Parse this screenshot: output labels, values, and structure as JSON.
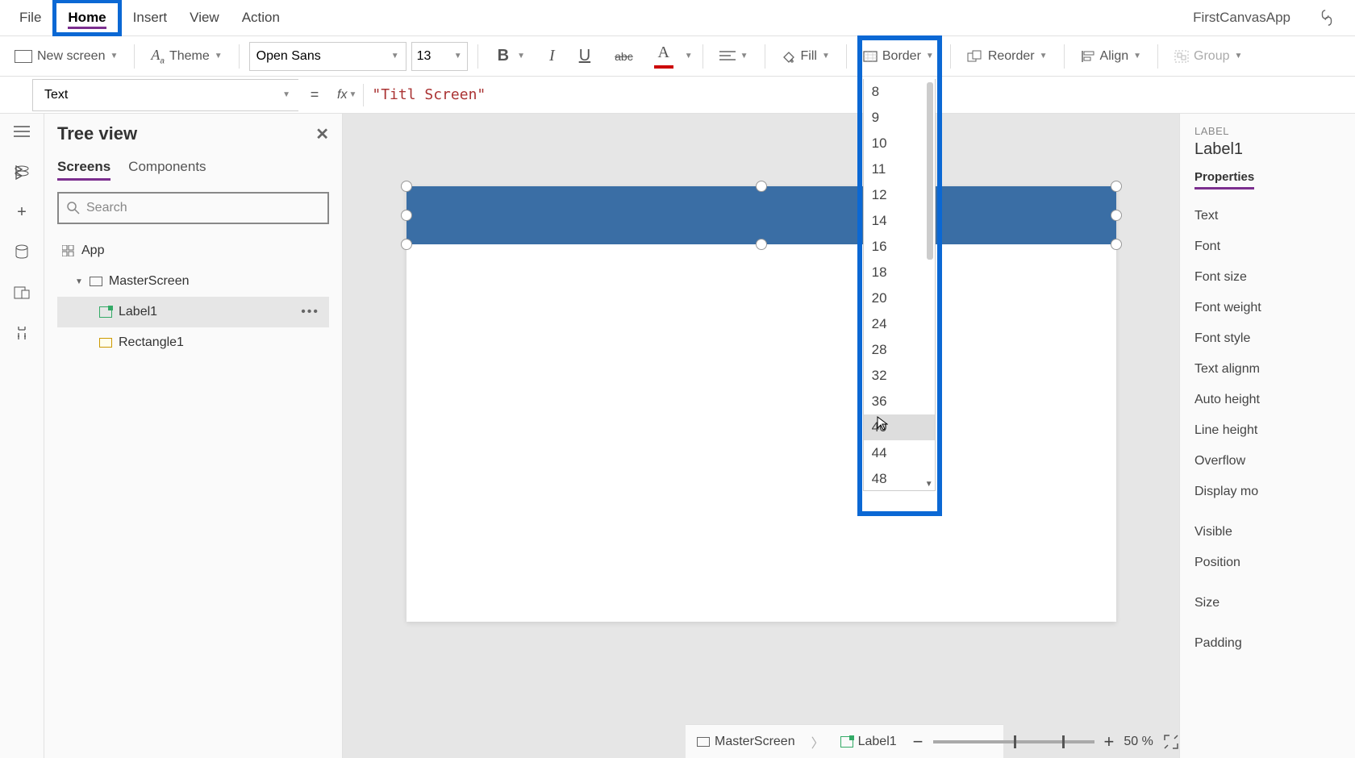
{
  "app_title": "FirstCanvasApp",
  "menu": {
    "file": "File",
    "home": "Home",
    "insert": "Insert",
    "view": "View",
    "action": "Action"
  },
  "toolbar": {
    "new_screen": "New screen",
    "theme": "Theme",
    "font_name": "Open Sans",
    "font_size": "13",
    "fill": "Fill",
    "border": "Border",
    "reorder": "Reorder",
    "align": "Align",
    "group": "Group"
  },
  "font_sizes": [
    "8",
    "9",
    "10",
    "11",
    "12",
    "14",
    "16",
    "18",
    "20",
    "24",
    "28",
    "32",
    "36",
    "40",
    "44",
    "48"
  ],
  "font_size_hovered_index": 13,
  "formula": {
    "property": "Text",
    "value": "\"Titl        Screen\""
  },
  "tree": {
    "title": "Tree view",
    "tabs": {
      "screens": "Screens",
      "components": "Components"
    },
    "search_placeholder": "Search",
    "items": {
      "app": "App",
      "screen": "MasterScreen",
      "label": "Label1",
      "rect": "Rectangle1"
    }
  },
  "right_panel": {
    "section": "LABEL",
    "name": "Label1",
    "tab": "Properties",
    "rows": [
      "Text",
      "Font",
      "Font size",
      "Font weight",
      "Font style",
      "Text alignm",
      "Auto height",
      "Line height",
      "Overflow",
      "Display mo",
      "",
      "Visible",
      "Position",
      "",
      "Size",
      "",
      "Padding"
    ]
  },
  "breadcrumb": {
    "screen": "MasterScreen",
    "ctrl": "Label1"
  },
  "zoom": {
    "value": "50",
    "unit": "%"
  }
}
